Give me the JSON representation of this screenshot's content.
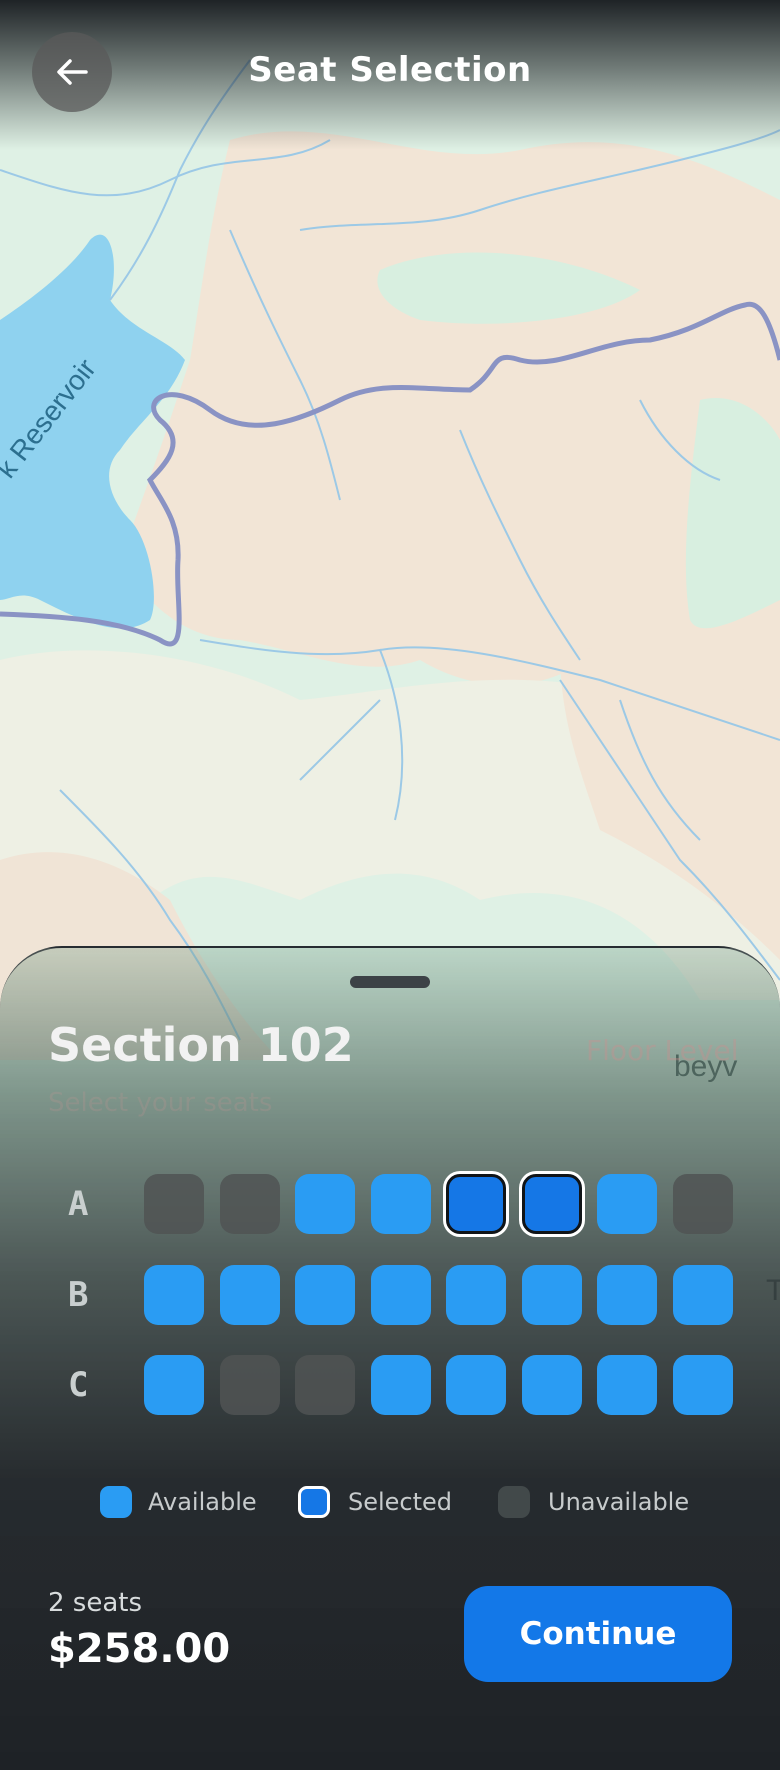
{
  "header": {
    "title": "Seat Selection",
    "back_icon": "arrow-left-icon"
  },
  "map": {
    "reservoir_label": "k Reservoir",
    "edge_labels": [
      "beyv",
      "T"
    ]
  },
  "sheet": {
    "section_title": "Section 102",
    "floor_level": "Floor Level",
    "subtitle": "Select your seats"
  },
  "rows": [
    {
      "label": "A",
      "seats": [
        "unavailable",
        "unavailable",
        "available",
        "available",
        "selected",
        "selected",
        "available",
        "unavailable"
      ]
    },
    {
      "label": "B",
      "seats": [
        "available",
        "available",
        "available",
        "available",
        "available",
        "available",
        "available",
        "available"
      ]
    },
    {
      "label": "C",
      "seats": [
        "available",
        "unavailable",
        "unavailable",
        "available",
        "available",
        "available",
        "available",
        "available"
      ]
    }
  ],
  "legend": {
    "available": "Available",
    "selected": "Selected",
    "unavailable": "Unavailable"
  },
  "footer": {
    "seat_count": "2 seats",
    "total": "$258.00",
    "continue_label": "Continue"
  },
  "colors": {
    "available": "#2a9cf3",
    "selected": "#1577e6",
    "unavailable": "#505454",
    "accent": "#1378e8"
  }
}
